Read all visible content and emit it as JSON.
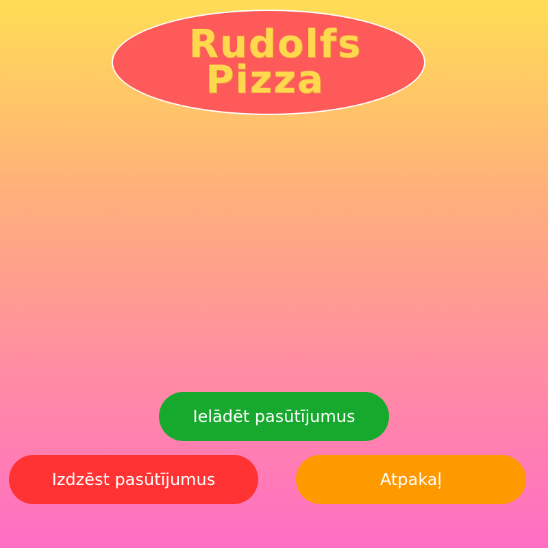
{
  "logo": {
    "line1": "Rudolfs",
    "line2": "Pizza"
  },
  "buttons": {
    "load": "Ielādēt pasūtījumus",
    "delete": "Izdzēst pasūtījumus",
    "back": "Atpakaļ"
  },
  "colors": {
    "logo_fill": "#ff5a5a",
    "logo_text": "#ffd84d",
    "load_button": "#17a92d",
    "delete_button": "#ff3333",
    "back_button": "#ff9900"
  }
}
